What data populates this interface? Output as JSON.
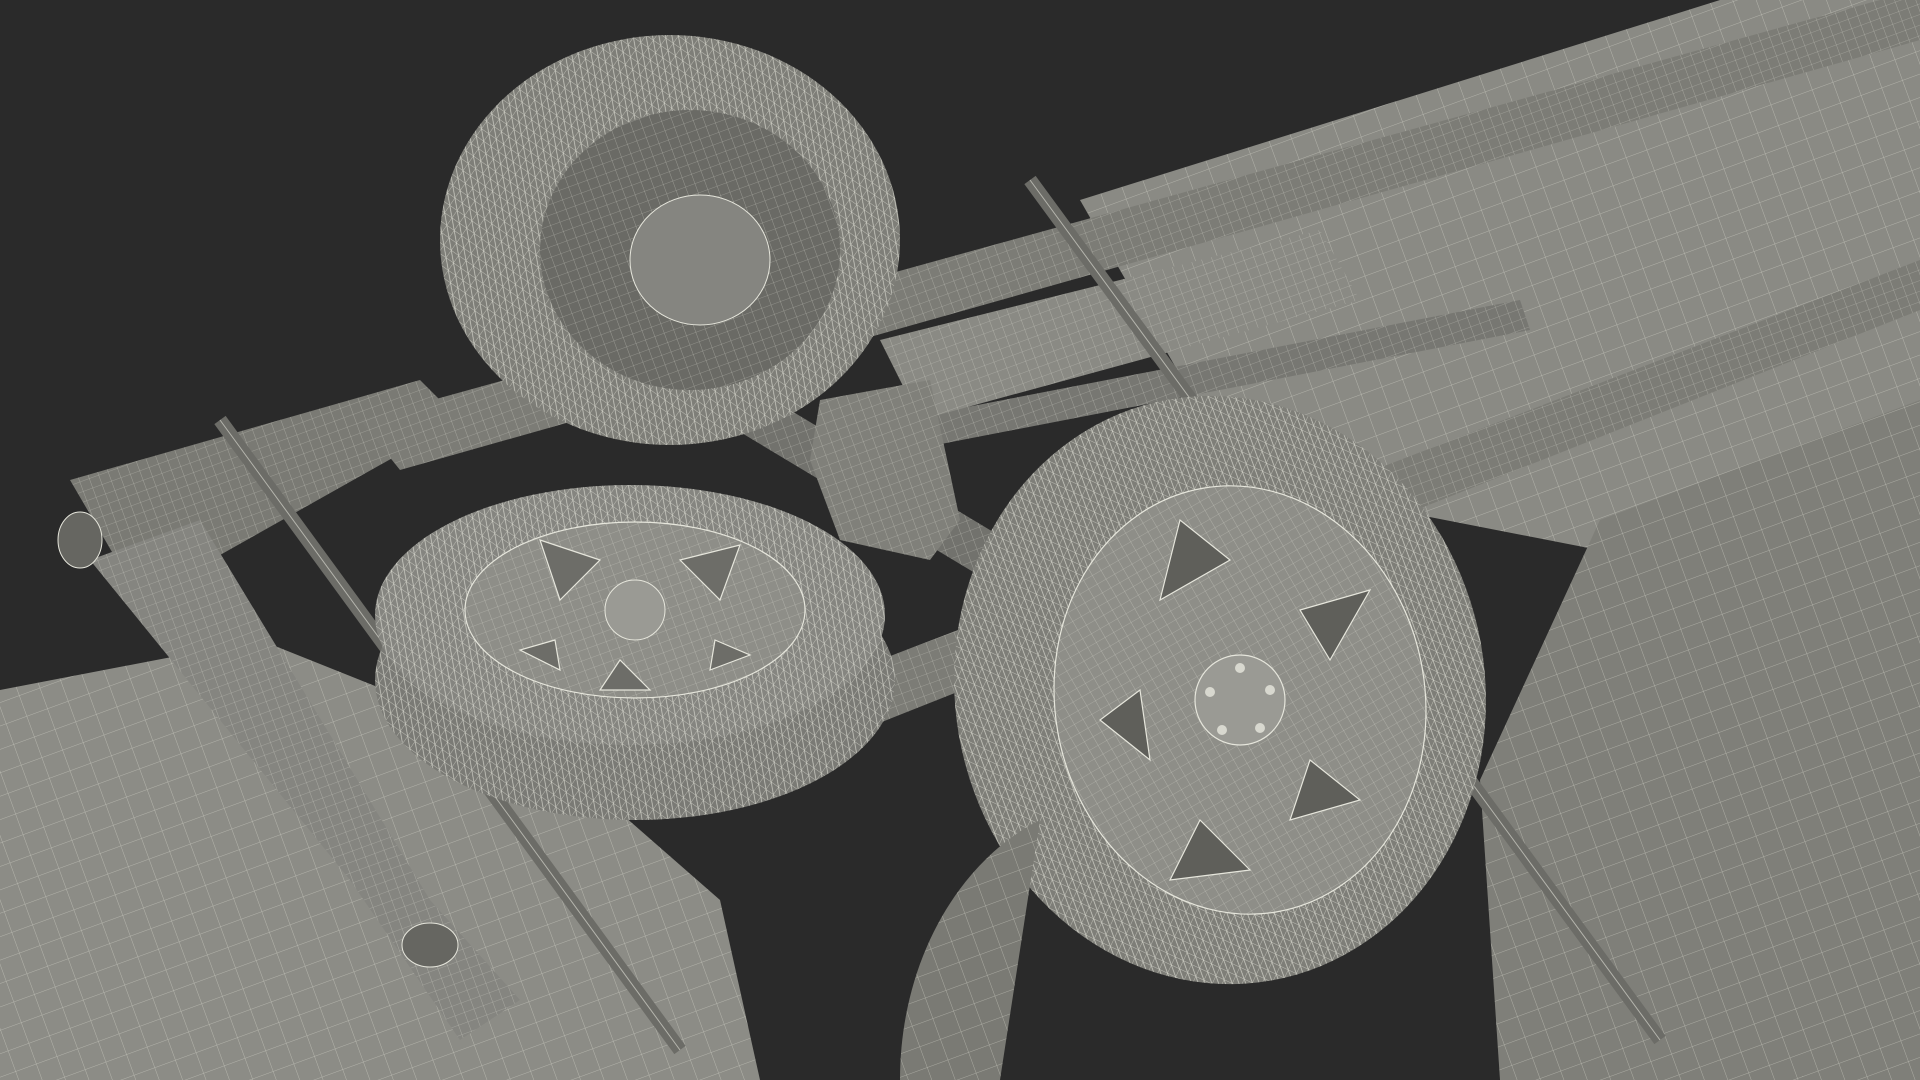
{
  "scene": {
    "subject": "truck-undercarriage-wireframe",
    "colors": {
      "background": "#2a2a2a",
      "body": "#8a8a84",
      "body_dark": "#6f6f6a",
      "body_light": "#9c9c96",
      "tire": "#7e7e78",
      "wire": "#e6e6dc"
    }
  }
}
